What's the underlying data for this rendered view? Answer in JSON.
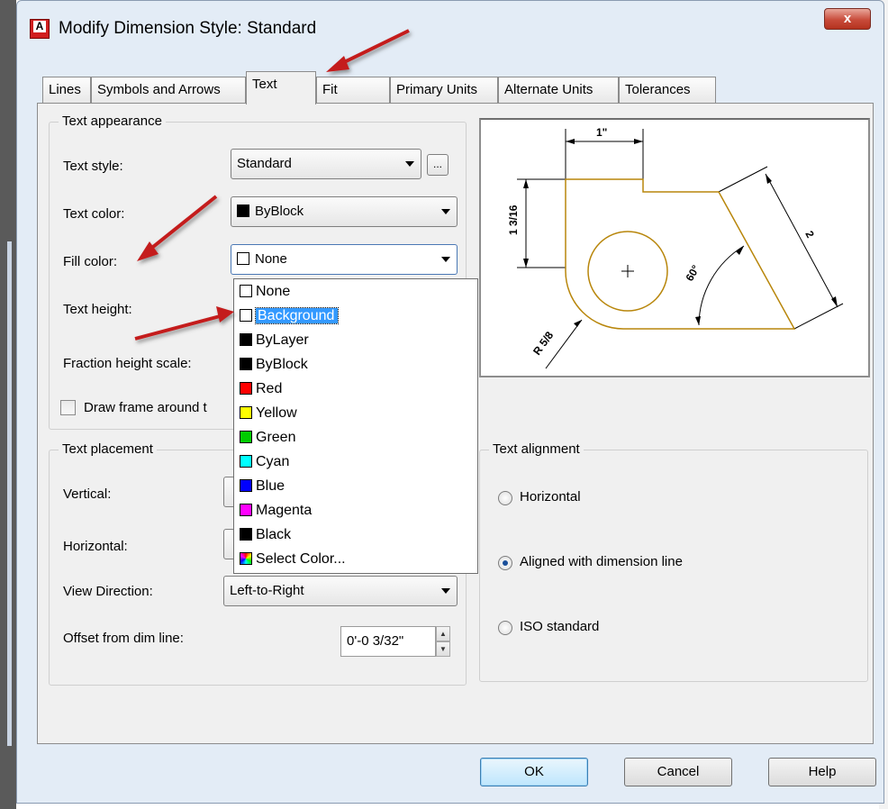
{
  "window": {
    "title": "Modify Dimension Style: Standard",
    "close_label": "x"
  },
  "tabs": [
    {
      "label": "Lines",
      "active": false
    },
    {
      "label": "Symbols and Arrows",
      "active": false
    },
    {
      "label": "Text",
      "active": true
    },
    {
      "label": "Fit",
      "active": false
    },
    {
      "label": "Primary Units",
      "active": false
    },
    {
      "label": "Alternate Units",
      "active": false
    },
    {
      "label": "Tolerances",
      "active": false
    }
  ],
  "text_appearance": {
    "title": "Text appearance",
    "text_style": {
      "label": "Text style:",
      "value": "Standard",
      "browse_label": "..."
    },
    "text_color": {
      "label": "Text color:",
      "value": "ByBlock",
      "swatch": "#000000"
    },
    "fill_color": {
      "label": "Fill color:",
      "value": "None",
      "swatch": "#ffffff"
    },
    "text_height": {
      "label": "Text height:"
    },
    "fraction_height_scale": {
      "label": "Fraction height scale:"
    },
    "draw_frame": {
      "label": "Draw frame around t",
      "checked": false
    }
  },
  "fill_color_options": [
    {
      "label": "None",
      "swatch": "#ffffff",
      "selected": false
    },
    {
      "label": "Background",
      "swatch": "#ffffff",
      "selected": true
    },
    {
      "label": "ByLayer",
      "swatch": "#000000",
      "selected": false
    },
    {
      "label": "ByBlock",
      "swatch": "#000000",
      "selected": false
    },
    {
      "label": "Red",
      "swatch": "#ff0000",
      "selected": false
    },
    {
      "label": "Yellow",
      "swatch": "#ffff00",
      "selected": false
    },
    {
      "label": "Green",
      "swatch": "#00cc00",
      "selected": false
    },
    {
      "label": "Cyan",
      "swatch": "#00ffff",
      "selected": false
    },
    {
      "label": "Blue",
      "swatch": "#0000ff",
      "selected": false
    },
    {
      "label": "Magenta",
      "swatch": "#ff00ff",
      "selected": false
    },
    {
      "label": "Black",
      "swatch": "#000000",
      "selected": false
    },
    {
      "label": "Select Color...",
      "swatch": "gradient",
      "selected": false
    }
  ],
  "text_placement": {
    "title": "Text placement",
    "vertical": {
      "label": "Vertical:"
    },
    "horizontal": {
      "label": "Horizontal:"
    },
    "view_direction": {
      "label": "View Direction:",
      "value": "Left-to-Right"
    },
    "offset": {
      "label": "Offset from dim line:",
      "value": "0'-0 3/32\""
    }
  },
  "text_alignment": {
    "title": "Text alignment",
    "options": [
      {
        "label": "Horizontal",
        "checked": false
      },
      {
        "label": "Aligned with dimension line",
        "checked": true
      },
      {
        "label": "ISO standard",
        "checked": false
      }
    ]
  },
  "preview": {
    "dim_top": "1\"",
    "dim_left": "1 3/16",
    "dim_right": "2",
    "dim_angle": "60°",
    "dim_radius": "R 5/8"
  },
  "buttons": {
    "ok": "OK",
    "cancel": "Cancel",
    "help": "Help"
  },
  "colors": {
    "arrow": "#c41e1e",
    "preview_geometry": "#b8860b",
    "selection": "#3399ff"
  }
}
